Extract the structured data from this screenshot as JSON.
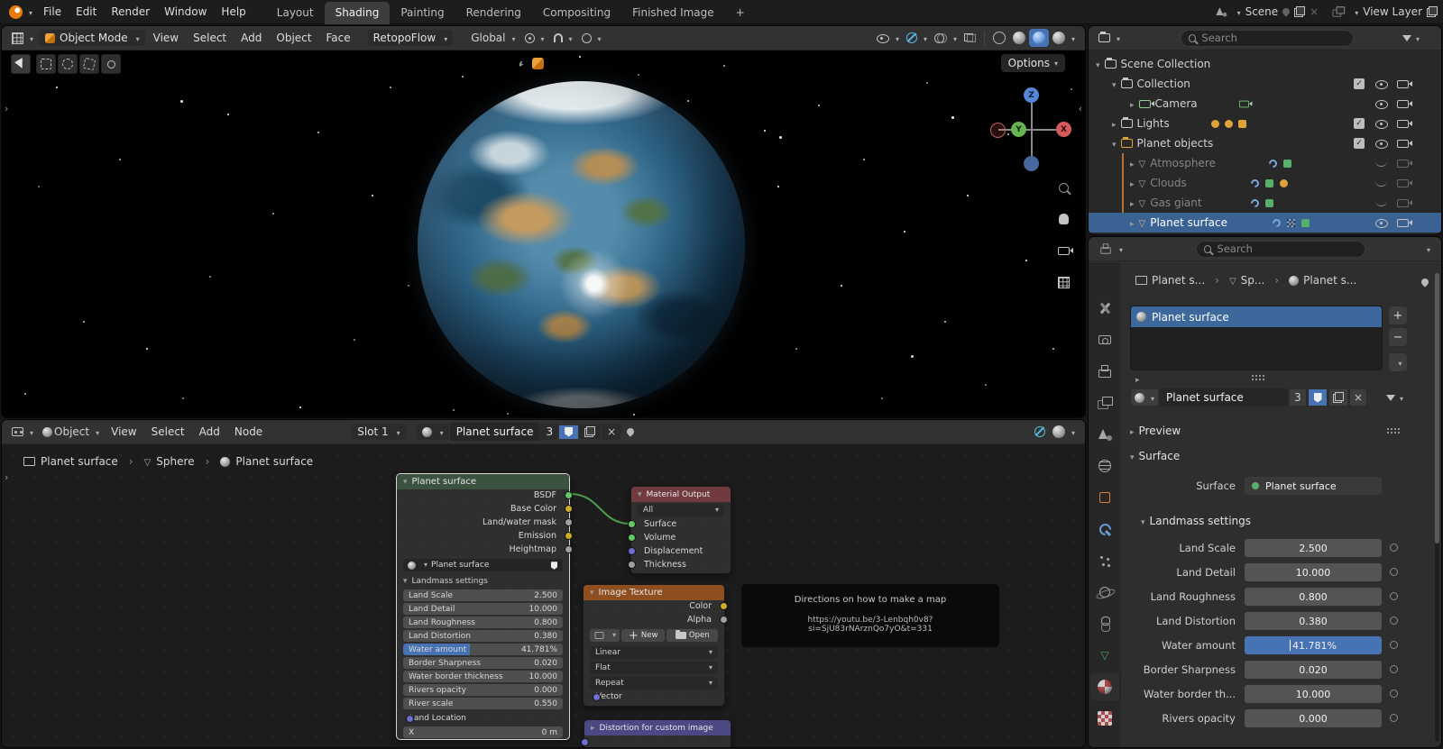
{
  "icons": {
    "chevron_down": "▾",
    "chevron_right": "▸",
    "breadcrumb_sep": "›",
    "check": "✓",
    "close": "×",
    "plus": "+",
    "minus": "−",
    "mesh_triangle": "▽"
  },
  "accents": {
    "selection_blue": "#4772b3",
    "outliner_selected_row": "#3a6292",
    "node_group_header": "#3a523e",
    "node_output_header": "#703a3f",
    "node_texture_header": "#8f4e1f",
    "node_distort_header": "#4c4884",
    "socket_shader": "#63c763",
    "socket_color": "#ccab2d",
    "socket_vector": "#6e6ed0",
    "socket_value": "#9f9f9f",
    "link_green": "#4e9b4e"
  },
  "topbar": {
    "menus": [
      "File",
      "Edit",
      "Render",
      "Window",
      "Help"
    ],
    "tabs": [
      {
        "label": "Layout"
      },
      {
        "label": "Shading"
      },
      {
        "label": "Painting"
      },
      {
        "label": "Rendering"
      },
      {
        "label": "Compositing"
      },
      {
        "label": "Finished Image"
      },
      {
        "label": "+"
      }
    ],
    "scene_label": "Scene",
    "view_layer_label": "View Layer"
  },
  "viewport": {
    "mode": "Object Mode",
    "menus": [
      "View",
      "Select",
      "Add",
      "Object",
      "Face"
    ],
    "retopoflow": "RetopoFlow",
    "orientation": "Global",
    "options": "Options",
    "gizmo": {
      "x": "X",
      "y": "Y",
      "z": "Z"
    }
  },
  "shader": {
    "type": "Object",
    "menus": [
      "View",
      "Select",
      "Add",
      "Node"
    ],
    "slot": "Slot 1",
    "material": "Planet surface",
    "users": "3",
    "breadcrumb": [
      "Planet surface",
      "Sphere",
      "Planet surface"
    ]
  },
  "nodes": {
    "group": {
      "title": "Planet surface",
      "outputs": [
        "BSDF",
        "Base Color",
        "Land/water mask",
        "Emission",
        "Heightmap"
      ],
      "datablock": "Planet surface",
      "section": "Landmass settings",
      "params": [
        {
          "label": "Land Scale",
          "value": "2.500"
        },
        {
          "label": "Land Detail",
          "value": "10.000"
        },
        {
          "label": "Land Roughness",
          "value": "0.800"
        },
        {
          "label": "Land Distortion",
          "value": "0.380"
        },
        {
          "label": "Water amount",
          "value": "41.781%",
          "fill": "41.781%"
        },
        {
          "label": "Border Sharpness",
          "value": "0.020"
        },
        {
          "label": "Water border thickness",
          "value": "10.000"
        },
        {
          "label": "Rivers opacity",
          "value": "0.000"
        },
        {
          "label": "River scale",
          "value": "0.550"
        }
      ],
      "location_label": "Land Location",
      "x_label": "X",
      "x_value": "0 m"
    },
    "output": {
      "title": "Material Output",
      "target": "All",
      "inputs": [
        "Surface",
        "Volume",
        "Displacement",
        "Thickness"
      ]
    },
    "image": {
      "title": "Image Texture",
      "outputs": [
        "Color",
        "Alpha"
      ],
      "new_label": "New",
      "open_label": "Open",
      "interpolation": "Linear",
      "projection": "Flat",
      "extension": "Repeat",
      "vector_label": "Vector"
    },
    "note": {
      "title": "Directions on how to make a map",
      "url": "https://youtu.be/3-Lenbqh0v8?si=SjU83rNArznQo7yO&t=331"
    },
    "distortion": {
      "title": "Distortion for custom image"
    }
  },
  "outliner": {
    "search_placeholder": "Search",
    "items": [
      {
        "label": "Scene Collection"
      },
      {
        "label": "Collection"
      },
      {
        "label": "Camera"
      },
      {
        "label": "Lights"
      },
      {
        "label": "Planet objects"
      },
      {
        "label": "Atmosphere"
      },
      {
        "label": "Clouds"
      },
      {
        "label": "Gas giant"
      },
      {
        "label": "Planet surface"
      }
    ]
  },
  "properties": {
    "search_placeholder": "Search",
    "breadcrumb": [
      "Planet s...",
      "Sp...",
      "Planet s..."
    ],
    "slot_name": "Planet surface",
    "material_name": "Planet surface",
    "users": "3",
    "preview_label": "Preview",
    "surface_panel": "Surface",
    "surface_label": "Surface",
    "surface_value": "Planet surface",
    "landmass_label": "Landmass settings",
    "params": [
      {
        "label": "Land Scale",
        "value": "2.500"
      },
      {
        "label": "Land Detail",
        "value": "10.000"
      },
      {
        "label": "Land Roughness",
        "value": "0.800"
      },
      {
        "label": "Land Distortion",
        "value": "0.380"
      },
      {
        "label": "Water amount",
        "value": "41.781%"
      },
      {
        "label": "Border Sharpness",
        "value": "0.020"
      },
      {
        "label": "Water border th...",
        "value": "10.000"
      },
      {
        "label": "Rivers opacity",
        "value": "0.000"
      }
    ]
  }
}
